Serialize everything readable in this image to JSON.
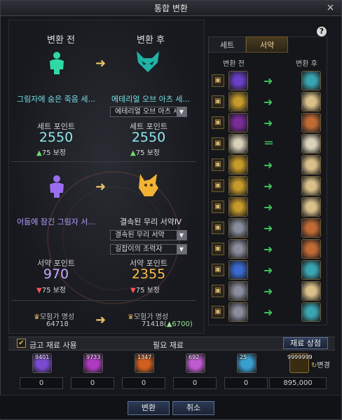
{
  "window": {
    "title": "통합 변환",
    "close_glyph": "×",
    "help_glyph": "?"
  },
  "left": {
    "before_header": "변환 전",
    "after_header": "변환 후",
    "set": {
      "before_name": "그림자에 숨은 죽음 세...",
      "after_name": "에테리얼 오브 아츠 세...",
      "dropdown": "에테리얼 오브 아츠 세",
      "before_label": "세트 포인트",
      "after_label": "세트 포인트",
      "before_points": "2550",
      "after_points": "2550",
      "before_bonus": "75 보정",
      "after_bonus": "75 보정"
    },
    "scroll": {
      "before_name": "어둠에 잠긴 그림자 서...",
      "after_name": "결속된 무리 서약Ⅳ",
      "dropdown1": "결속된 무리 서약",
      "dropdown2": "길잡이의 조력자",
      "before_label": "서약 포인트",
      "after_label": "서약 포인트",
      "before_points": "970",
      "after_points": "2355",
      "before_bonus": "75 보정",
      "after_bonus": "75 보정"
    },
    "fame": {
      "before_label": "모험가 명성",
      "after_label": "모험가 명성",
      "before_value": "64718",
      "after_value": "71418",
      "after_gain": "(▲6700)"
    }
  },
  "right": {
    "tabs": [
      "세트",
      "서약"
    ],
    "active_tab": "서약",
    "col_before": "변환 전",
    "col_after": "변환 후",
    "rows": [
      {
        "gem": "#6a3fc7",
        "res": "#3aa3b0",
        "eq": false
      },
      {
        "gem": "#c79b2b",
        "res": "#d9c08a",
        "eq": false
      },
      {
        "gem": "#7a2d9a",
        "res": "#c06a35",
        "eq": false
      },
      {
        "gem": "#d8d0b8",
        "res": "#d8d0b8",
        "eq": true
      },
      {
        "gem": "#c79b2b",
        "res": "#d9c08a",
        "eq": false
      },
      {
        "gem": "#c79b2b",
        "res": "#d9c08a",
        "eq": false
      },
      {
        "gem": "#c79b2b",
        "res": "#d9c08a",
        "eq": false
      },
      {
        "gem": "#8a8e9c",
        "res": "#c06a35",
        "eq": false
      },
      {
        "gem": "#8a8e9c",
        "res": "#c06a35",
        "eq": false
      },
      {
        "gem": "#3a6ad0",
        "res": "#3aa3b0",
        "eq": false
      },
      {
        "gem": "#8a8e9c",
        "res": "#d9c08a",
        "eq": false
      },
      {
        "gem": "#8a8e9c",
        "res": "#3aa3b0",
        "eq": false
      }
    ]
  },
  "materials": {
    "use_stash_label": "금고 재료 사용",
    "use_stash_checked": true,
    "required_label": "필요 재료",
    "shop_button": "재료 상점",
    "items": [
      {
        "count": "9401",
        "qty": "0",
        "color": "#7a4ad0"
      },
      {
        "count": "9733",
        "qty": "0",
        "color": "#b03ac0"
      },
      {
        "count": "1347",
        "qty": "0",
        "color": "#d0601f"
      },
      {
        "count": "692",
        "qty": "0",
        "color": "#c05ad0"
      },
      {
        "count": "25",
        "qty": "0",
        "color": "#3a9fd0"
      }
    ],
    "gold_count": "9999999",
    "gold_qty": "895,000",
    "change_label": "변경"
  },
  "buttons": {
    "convert": "변환",
    "cancel": "취소"
  }
}
